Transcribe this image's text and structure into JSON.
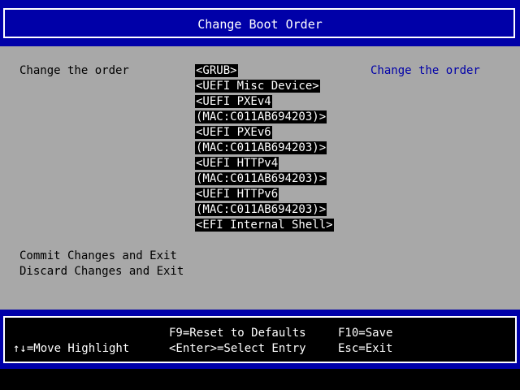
{
  "colors": {
    "header_bg": "#0000a8",
    "panel_bg": "#a8a8a8",
    "help_text": "#0000a8",
    "highlight_bg": "#000000",
    "highlight_fg": "#ffffff"
  },
  "header": {
    "title": "Change Boot Order"
  },
  "main": {
    "field_label": "Change the order",
    "help_text": "Change the order",
    "boot_order": [
      "<GRUB>",
      "<UEFI Misc Device>",
      "<UEFI PXEv4",
      "(MAC:C011AB694203)>",
      "<UEFI PXEv6",
      "(MAC:C011AB694203)>",
      "<UEFI HTTPv4",
      "(MAC:C011AB694203)>",
      "<UEFI HTTPv6",
      "(MAC:C011AB694203)>",
      "<EFI Internal Shell>"
    ],
    "actions": {
      "commit": "Commit Changes and Exit",
      "discard": "Discard Changes and Exit"
    }
  },
  "footer": {
    "move_highlight": "↑↓=Move Highlight",
    "reset_defaults": "F9=Reset to Defaults",
    "select_entry": "<Enter>=Select Entry",
    "save": "F10=Save",
    "exit": "Esc=Exit"
  }
}
